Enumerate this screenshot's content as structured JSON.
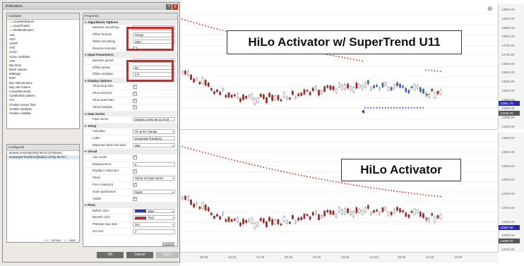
{
  "dialog": {
    "title": "Indicators",
    "help_label": "?",
    "close_label": "X",
    "available_header": "Available",
    "available_items": [
      {
        "label": "LizardIndicators",
        "folder": true
      },
      {
        "label": "LizardTrader",
        "folder": true
      },
      {
        "label": "SharkIndicators",
        "folder": true
      },
      {
        "label": "ADL",
        "folder": false
      },
      {
        "label": "ADX",
        "folder": false
      },
      {
        "label": "ADXR",
        "folder": false
      },
      {
        "label": "APZ",
        "folder": false
      },
      {
        "label": "Aroon",
        "folder": false
      },
      {
        "label": "Aroon oscillator",
        "folder": false
      },
      {
        "label": "ATR",
        "folder": false
      },
      {
        "label": "Bar timer",
        "folder": false
      },
      {
        "label": "Block volume",
        "folder": false
      },
      {
        "label": "Bollinger",
        "folder": false
      },
      {
        "label": "BOP",
        "folder": false
      },
      {
        "label": "Buy sell pressure",
        "folder": false
      },
      {
        "label": "Buy sell volume",
        "folder": false
      },
      {
        "label": "Camarilla pivots",
        "folder": false
      },
      {
        "label": "Candlestick pattern",
        "folder": false
      },
      {
        "label": "CCI",
        "folder": false
      },
      {
        "label": "Chaikin money flow",
        "folder": false
      },
      {
        "label": "Chaikin oscillator",
        "folder": false
      },
      {
        "label": "Chaikin volatility",
        "folder": false
      }
    ],
    "configured_header": "Configured",
    "configured_items": [
      "amaHiLoActivator(NQ 06-22 (5 Minute),",
      "amaSuperTrendU11(Median of NQ 06-22 ("
    ],
    "configured_actions": {
      "add": "add",
      "remove": "remove",
      "up": "up",
      "down": "down"
    },
    "properties_header": "Properties",
    "sections": [
      {
        "title": "Algorithmic Options",
        "rows": [
          {
            "label": "Baseline smoothing",
            "type": "dropdown",
            "value": "SMA"
          },
          {
            "label": "Offset formula",
            "type": "dropdown",
            "value": "Range"
          },
          {
            "label": "Offset smoothing",
            "type": "dropdown",
            "value": "SMA"
          },
          {
            "label": "Reverse intra-bar",
            "type": "check",
            "value": ""
          }
        ]
      },
      {
        "title": "Input Parameters",
        "rows": [
          {
            "label": "Baseline period",
            "type": "text",
            "value": "50"
          },
          {
            "label": "Offset period",
            "type": "text",
            "value": "50"
          },
          {
            "label": "Offset multiplier",
            "type": "text",
            "value": "0.5"
          }
        ]
      },
      {
        "title": "Display Options",
        "rows": [
          {
            "label": "Show stop dots",
            "type": "check",
            "value": "✓"
          },
          {
            "label": "Show stop line",
            "type": "check",
            "value": "✓"
          },
          {
            "label": "Show paint bars",
            "type": "check",
            "value": "✓"
          },
          {
            "label": "Show triangles",
            "type": "check",
            "value": "✓"
          }
        ]
      },
      {
        "title": "Data Series",
        "rows": [
          {
            "label": "Input series",
            "type": "text",
            "value": "Median of NQ 06-22 (5 M"
          }
        ]
      },
      {
        "title": "Setup",
        "rows": [
          {
            "label": "Calculate",
            "type": "dropdown",
            "value": "On price change"
          },
          {
            "label": "Label",
            "type": "text",
            "value": "amaSuperTrendU11"
          },
          {
            "label": "Maximum bars look back",
            "type": "dropdown",
            "value": "256"
          }
        ]
      },
      {
        "title": "Visual",
        "rows": [
          {
            "label": "Auto scale",
            "type": "check",
            "value": "✓"
          },
          {
            "label": "Displacement",
            "type": "text",
            "value": "0"
          },
          {
            "label": "Display in Data Box",
            "type": "check",
            "value": "✓"
          },
          {
            "label": "Panel",
            "type": "dropdown",
            "value": "Same as input series"
          },
          {
            "label": "Price marker(s)",
            "type": "check",
            "value": "✓"
          },
          {
            "label": "Scale justification",
            "type": "dropdown",
            "value": "Right"
          },
          {
            "label": "Visible",
            "type": "check",
            "value": "✓"
          }
        ]
      },
      {
        "title": "Plots",
        "rows": [
          {
            "label": "Bullish color",
            "type": "color",
            "value": "Blue",
            "color": "#1a2bd8"
          },
          {
            "label": "Bearish color",
            "type": "color",
            "value": "Red",
            "color": "#e02020"
          },
          {
            "label": "Plotstyle stop dots",
            "type": "dropdown",
            "value": "Dot"
          },
          {
            "label": "Dot size",
            "type": "text",
            "value": "2"
          }
        ]
      }
    ],
    "template_link": "template",
    "ok_label": "OK",
    "cancel_label": "Cancel",
    "apply_label": "Apply"
  },
  "overlay": {
    "top_title": "HiLo Activator w/ SuperTrend U11",
    "bottom_title": "HiLo Activator"
  },
  "chart": {
    "top_axis_ticks": [
      "13950.00",
      "13900.00",
      "13850.00",
      "13800.00",
      "13750.00",
      "13700.00",
      "13650.00",
      "13600.00",
      "13550.00",
      "13500.00",
      "13450.00",
      "13400.00",
      "13350.00",
      "13300.00"
    ],
    "bottom_axis_ticks": [
      "13650.00",
      "13600.00",
      "13550.00",
      "13500.00",
      "13450.00",
      "13400.00",
      "13350.00",
      "13300.00",
      "13250.00"
    ],
    "top_price_tags": [
      {
        "text": "13361.75",
        "color": "#2a2ab0"
      },
      {
        "text": "13296.00",
        "color": "#555555"
      }
    ],
    "bottom_price_tags": [
      {
        "text": "13367.50",
        "color": "#2a2ab0"
      },
      {
        "text": "13296.00",
        "color": "#555555"
      }
    ],
    "x_ticks": [
      "09:00",
      "18:00",
      "21:00",
      "00:00",
      "03:00",
      "06:00",
      "14 Mrz",
      "09:00",
      "12:00",
      "15:00"
    ],
    "bullish_color": "#1a2bd8",
    "bearish_color": "#e02020",
    "candle_up_color": "#ffffff",
    "candle_down_color": "#c02020"
  }
}
